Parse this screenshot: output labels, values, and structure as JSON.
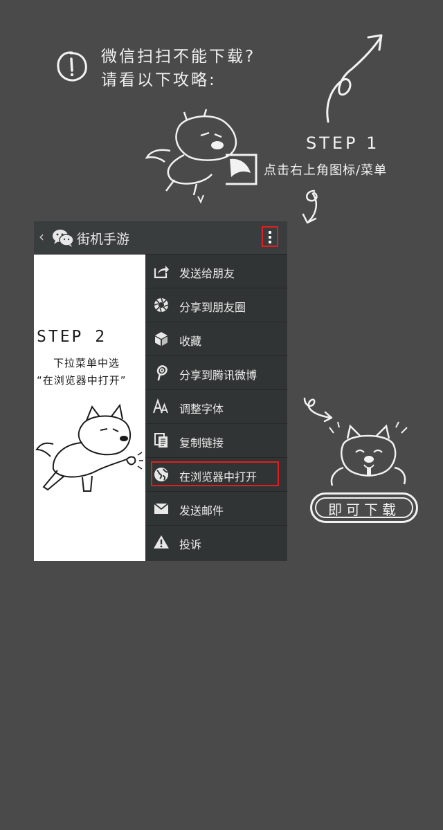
{
  "intro": {
    "line1": "微信扫扫不能下载?",
    "line2": "请看以下攻略:",
    "icon": "exclamation-circle-icon"
  },
  "step1": {
    "title": "STEP 1",
    "description": "点击右上角图标/菜单"
  },
  "phone": {
    "topbar": {
      "back_icon": "‹",
      "title": "街机手游"
    },
    "step2": {
      "title": "STEP 2",
      "line1": "下拉菜单中选",
      "line2": "“在浏览器中打开”"
    },
    "menu": [
      {
        "label": "发送给朋友",
        "icon": "share-icon"
      },
      {
        "label": "分享到朋友圈",
        "icon": "moments-icon"
      },
      {
        "label": "收藏",
        "icon": "cube-icon"
      },
      {
        "label": "分享到腾讯微博",
        "icon": "weibo-icon"
      },
      {
        "label": "调整字体",
        "icon": "font-size-icon"
      },
      {
        "label": "复制链接",
        "icon": "copy-icon"
      },
      {
        "label": "在浏览器中打开",
        "icon": "globe-icon",
        "highlighted": true
      },
      {
        "label": "发送邮件",
        "icon": "mail-icon"
      },
      {
        "label": "投诉",
        "icon": "warning-icon"
      }
    ]
  },
  "download": {
    "label": "即可下载"
  },
  "colors": {
    "background": "#4a4a4a",
    "highlight": "#e02020",
    "menu_bg": "#313434"
  }
}
